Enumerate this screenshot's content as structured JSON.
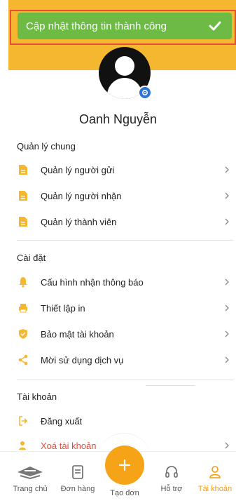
{
  "toast": {
    "message": "Cập nhật thông tin thành công"
  },
  "profile": {
    "name": "Oanh Nguyễn"
  },
  "sections": [
    {
      "title": "Quản lý chung",
      "items": [
        {
          "label": "Quản lý người gửi",
          "icon": "document-icon"
        },
        {
          "label": "Quản lý người nhận",
          "icon": "document-icon"
        },
        {
          "label": "Quản lý thành viên",
          "icon": "document-icon"
        }
      ]
    },
    {
      "title": "Cài đặt",
      "items": [
        {
          "label": "Cấu hình nhận thông báo",
          "icon": "bell-icon"
        },
        {
          "label": "Thiết lập in",
          "icon": "printer-icon"
        },
        {
          "label": "Bảo mật tài khoản",
          "icon": "shield-icon"
        },
        {
          "label": "Mời sử dụng dịch vụ",
          "icon": "share-icon"
        }
      ]
    },
    {
      "title": "Tài khoản",
      "items": [
        {
          "label": "Đăng xuất",
          "icon": "logout-icon"
        },
        {
          "label": "Xoá tài khoản",
          "icon": "user-remove-icon"
        }
      ]
    }
  ],
  "nav": {
    "home": "Trang chủ",
    "orders": "Đơn hàng",
    "create": "Tạo đơn",
    "support": "Hỗ trợ",
    "account": "Tài khoản"
  },
  "colors": {
    "brand": "#F6B730",
    "accent": "#F39C12",
    "success": "#6DBB45",
    "danger": "#E74C3C",
    "gear": "#2E74D6"
  }
}
